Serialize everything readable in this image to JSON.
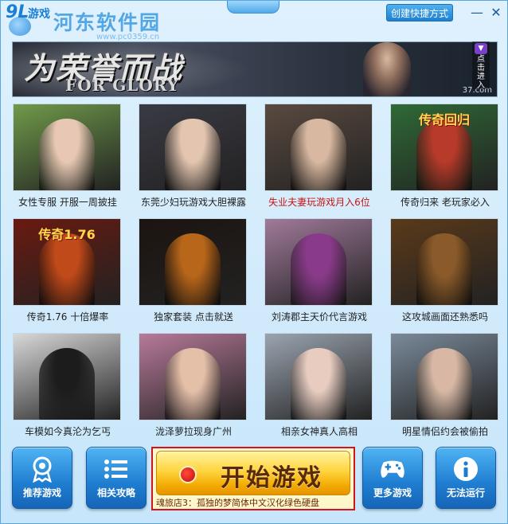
{
  "titlebar": {
    "logo_number": "9L",
    "logo_text": "游戏",
    "watermark": "河东软件园",
    "watermark_url": "www.pc0359.cn",
    "shortcut_label": "创建快捷方式",
    "minimize": "—",
    "close": "✕"
  },
  "banner": {
    "title_cn": "为荣誉而战",
    "title_en": "FOR GLORY",
    "site": "37.com",
    "more_label": "点击进入"
  },
  "tiles": [
    {
      "caption": "女性专服 开服一周披挂",
      "highlight": false,
      "bg": "#6f9a4a",
      "fig": "#e8c8b4",
      "art": ""
    },
    {
      "caption": "东莞少妇玩游戏大胆裸露",
      "highlight": false,
      "bg": "#3a3a44",
      "fig": "#e4c6b0",
      "art": ""
    },
    {
      "caption": "失业夫妻玩游戏月入6位",
      "highlight": true,
      "bg": "#5a4a40",
      "fig": "#d8b8a0",
      "art": ""
    },
    {
      "caption": "传奇归来 老玩家必入",
      "highlight": false,
      "bg": "#2f6a36",
      "fig": "#b83a2a",
      "art": "传奇回归"
    },
    {
      "caption": "传奇1.76 十倍爆率",
      "highlight": false,
      "bg": "#6a1a10",
      "fig": "#c04a1a",
      "art": "传奇1.76"
    },
    {
      "caption": "独家套装 点击就送",
      "highlight": false,
      "bg": "#1c1410",
      "fig": "#b8661a",
      "art": ""
    },
    {
      "caption": "刘涛郡主天价代言游戏",
      "highlight": false,
      "bg": "#a07a9a",
      "fig": "#8a3a8a",
      "art": ""
    },
    {
      "caption": "这攻城画面还熟悉吗",
      "highlight": false,
      "bg": "#5a3a1a",
      "fig": "#8a5a2a",
      "art": ""
    },
    {
      "caption": "车模如今真沦为乞丐",
      "highlight": false,
      "bg": "#d8d8d8",
      "fig": "#1c1c1c",
      "art": ""
    },
    {
      "caption": "泷泽萝拉现身广州",
      "highlight": false,
      "bg": "#b87a9a",
      "fig": "#e4c0a8",
      "art": ""
    },
    {
      "caption": "相亲女神真人高相",
      "highlight": false,
      "bg": "#9aa4b0",
      "fig": "#e8ccc0",
      "art": ""
    },
    {
      "caption": "明星情侣约会被偷拍",
      "highlight": false,
      "bg": "#7a8a9a",
      "fig": "#d8b8a4",
      "art": ""
    }
  ],
  "bottom": {
    "recommend": "推荐游戏",
    "guides": "相关攻略",
    "start": "开始游戏",
    "start_note": "魂旅店3：孤独的梦简体中文汉化绿色硬盘",
    "more_games": "更多游戏",
    "cannot_run": "无法运行"
  },
  "colors": {
    "accent": "#1f7fcf",
    "highlight_text": "#c81414",
    "start_frame": "#d0161c"
  }
}
